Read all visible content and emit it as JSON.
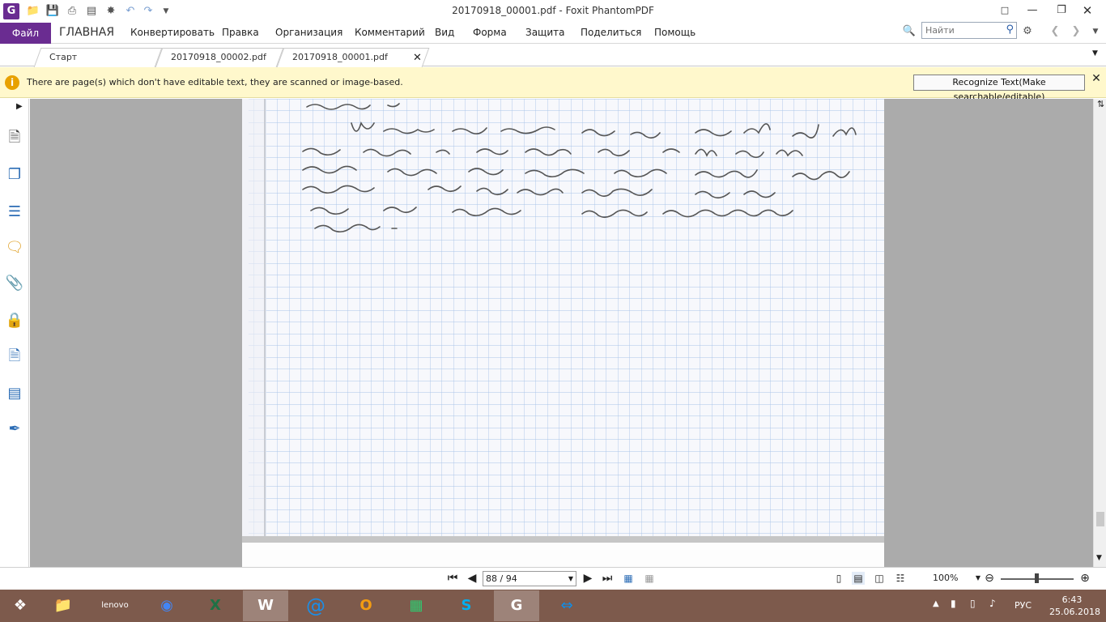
{
  "titlebar": {
    "title": "20170918_00001.pdf - Foxit PhantomPDF",
    "app_icon_letter": "G"
  },
  "menu": {
    "file": "Файл",
    "items": [
      "ГЛАВНАЯ",
      "Конвертировать",
      "Правка",
      "Организация",
      "Комментарий",
      "Вид",
      "Форма",
      "Защита",
      "Поделиться",
      "Помощь"
    ],
    "search_placeholder": "Найти"
  },
  "tabs": [
    {
      "label": "Старт",
      "active": false
    },
    {
      "label": "20170918_00002.pdf",
      "active": false
    },
    {
      "label": "20170918_00001.pdf",
      "active": true
    }
  ],
  "notice": {
    "text": "There are page(s) which don't have editable text, they are scanned or image-based.",
    "button": "Recognize Text(Make searchable/editable)"
  },
  "leftbar_icons": [
    "bookmarks-icon",
    "pages-icon",
    "layers-icon",
    "comments-icon",
    "attachments-icon",
    "security-icon",
    "document-properties-icon",
    "form-fields-icon",
    "signature-icon"
  ],
  "status": {
    "page": "88 / 94",
    "zoom": "100%"
  },
  "taskbar": {
    "lang": "РУС",
    "time": "6:43",
    "date": "25.06.2018"
  },
  "colors": {
    "accent": "#6a2c91",
    "notice_bg": "#fff8cc",
    "doc_bg": "#ababab",
    "taskbar": "#7d5a4c"
  }
}
